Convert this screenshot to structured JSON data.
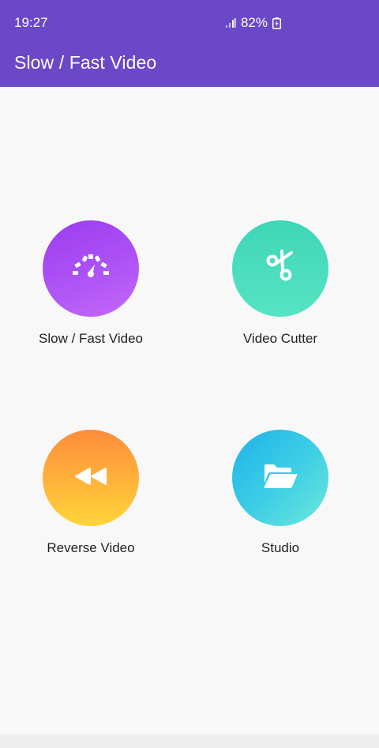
{
  "status_bar": {
    "time": "19:27",
    "battery": "82%",
    "signal_icon": "signal-icon",
    "battery_icon": "battery-charging-icon"
  },
  "app_bar": {
    "title": "Slow / Fast Video",
    "color": "#6a48c8"
  },
  "tiles": [
    {
      "label": "Slow / Fast Video",
      "icon": "speedometer-icon",
      "color": "#a84af4"
    },
    {
      "label": "Video Cutter",
      "icon": "scissors-icon",
      "color": "#4bdcbd"
    },
    {
      "label": "Reverse Video",
      "icon": "rewind-icon",
      "color": "#ffa03a"
    },
    {
      "label": "Studio",
      "icon": "folder-open-icon",
      "color": "#33c2e8"
    }
  ]
}
